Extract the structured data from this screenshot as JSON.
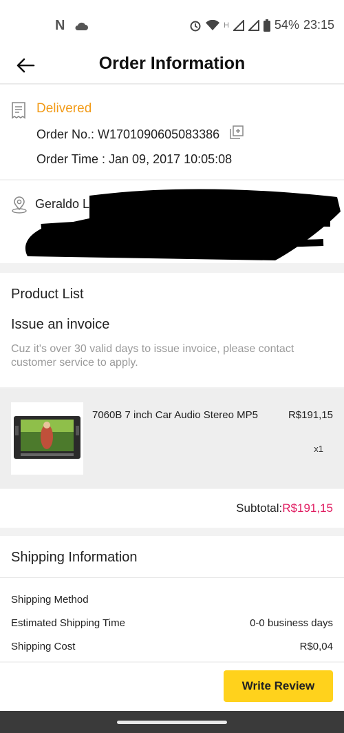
{
  "status_bar": {
    "battery": "54%",
    "time": "23:15",
    "notification_letter": "N"
  },
  "header": {
    "title": "Order Information"
  },
  "order": {
    "status": "Delivered",
    "order_no": "Order No.: W1701090605083386",
    "order_time": "Order Time : Jan 09, 2017 10:05:08"
  },
  "address": {
    "name": "Geraldo L"
  },
  "products": {
    "heading": "Product List",
    "invoice_heading": "Issue an invoice",
    "invoice_note": "Cuz it's over 30 valid days to issue invoice, please contact customer service to apply.",
    "item": {
      "name": "7060B 7 inch Car Audio Stereo MP5",
      "price": "R$191,15",
      "qty": "x1"
    }
  },
  "subtotal": {
    "label": "Subtotal:",
    "value": "R$191,15"
  },
  "shipping": {
    "heading": "Shipping Information",
    "rows": [
      {
        "label": "Shipping Method",
        "value": ""
      },
      {
        "label": "Estimated Shipping Time",
        "value": "0-0 business days"
      },
      {
        "label": "Shipping Cost",
        "value": "R$0,04"
      }
    ]
  },
  "actions": {
    "write_review": "Write Review"
  },
  "colors": {
    "accent_status": "#f29b18",
    "price_highlight": "#e0195f",
    "button": "#ffd21c"
  }
}
